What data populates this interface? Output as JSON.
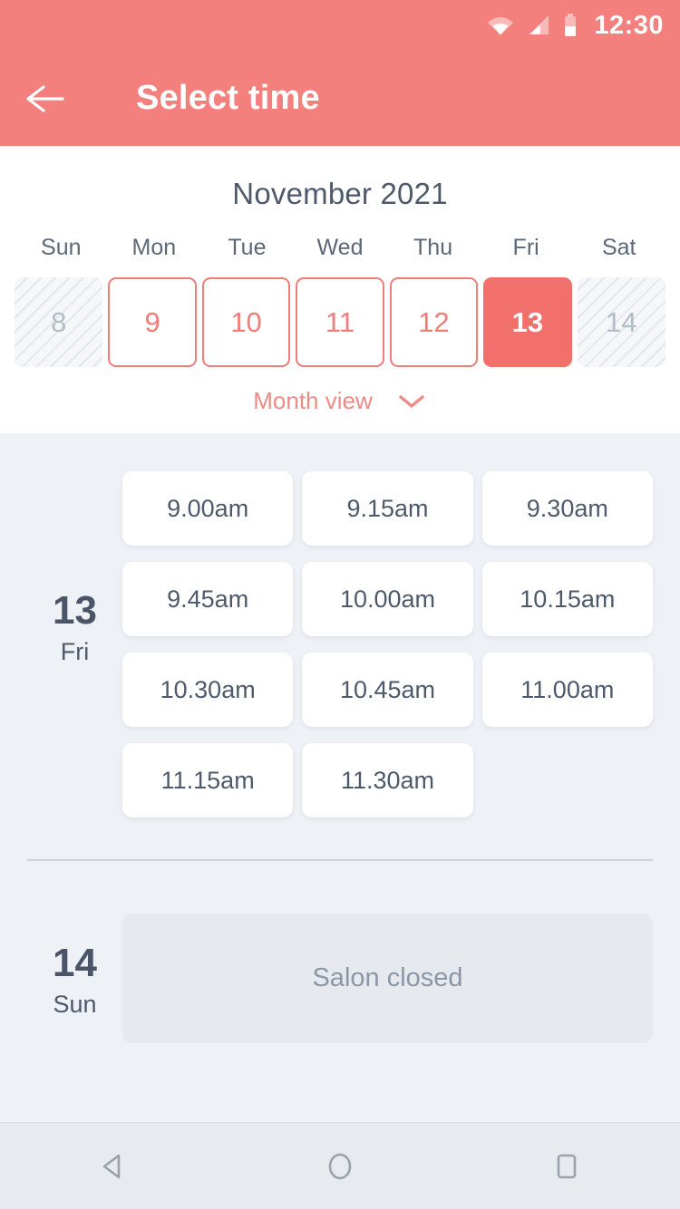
{
  "status_bar": {
    "time": "12:30",
    "icons": [
      "wifi-icon",
      "signal-icon",
      "battery-icon"
    ]
  },
  "app_bar": {
    "back_icon": "arrow-left-icon",
    "title": "Select time"
  },
  "calendar": {
    "month_title": "November 2021",
    "weekdays": [
      "Sun",
      "Mon",
      "Tue",
      "Wed",
      "Thu",
      "Fri",
      "Sat"
    ],
    "days": [
      {
        "num": "8",
        "state": "disabled"
      },
      {
        "num": "9",
        "state": "available"
      },
      {
        "num": "10",
        "state": "available"
      },
      {
        "num": "11",
        "state": "available"
      },
      {
        "num": "12",
        "state": "available"
      },
      {
        "num": "13",
        "state": "selected"
      },
      {
        "num": "14",
        "state": "disabled"
      }
    ],
    "month_view_label": "Month view",
    "month_view_icon": "chevron-down-icon"
  },
  "schedule": [
    {
      "day_num": "13",
      "day_dow": "Fri",
      "slots": [
        "9.00am",
        "9.15am",
        "9.30am",
        "9.45am",
        "10.00am",
        "10.15am",
        "10.30am",
        "10.45am",
        "11.00am",
        "11.15am",
        "11.30am"
      ]
    },
    {
      "day_num": "14",
      "day_dow": "Sun",
      "closed_label": "Salon closed"
    }
  ],
  "nav_bar": {
    "back_icon": "triangle-back-icon",
    "home_icon": "circle-home-icon",
    "recents_icon": "square-recents-icon"
  },
  "colors": {
    "accent": "#f3807d",
    "accent_selected": "#f2706c",
    "accent_border": "#ef7d78",
    "text_dark": "#4a5568",
    "bg_content": "#eef1f6"
  }
}
